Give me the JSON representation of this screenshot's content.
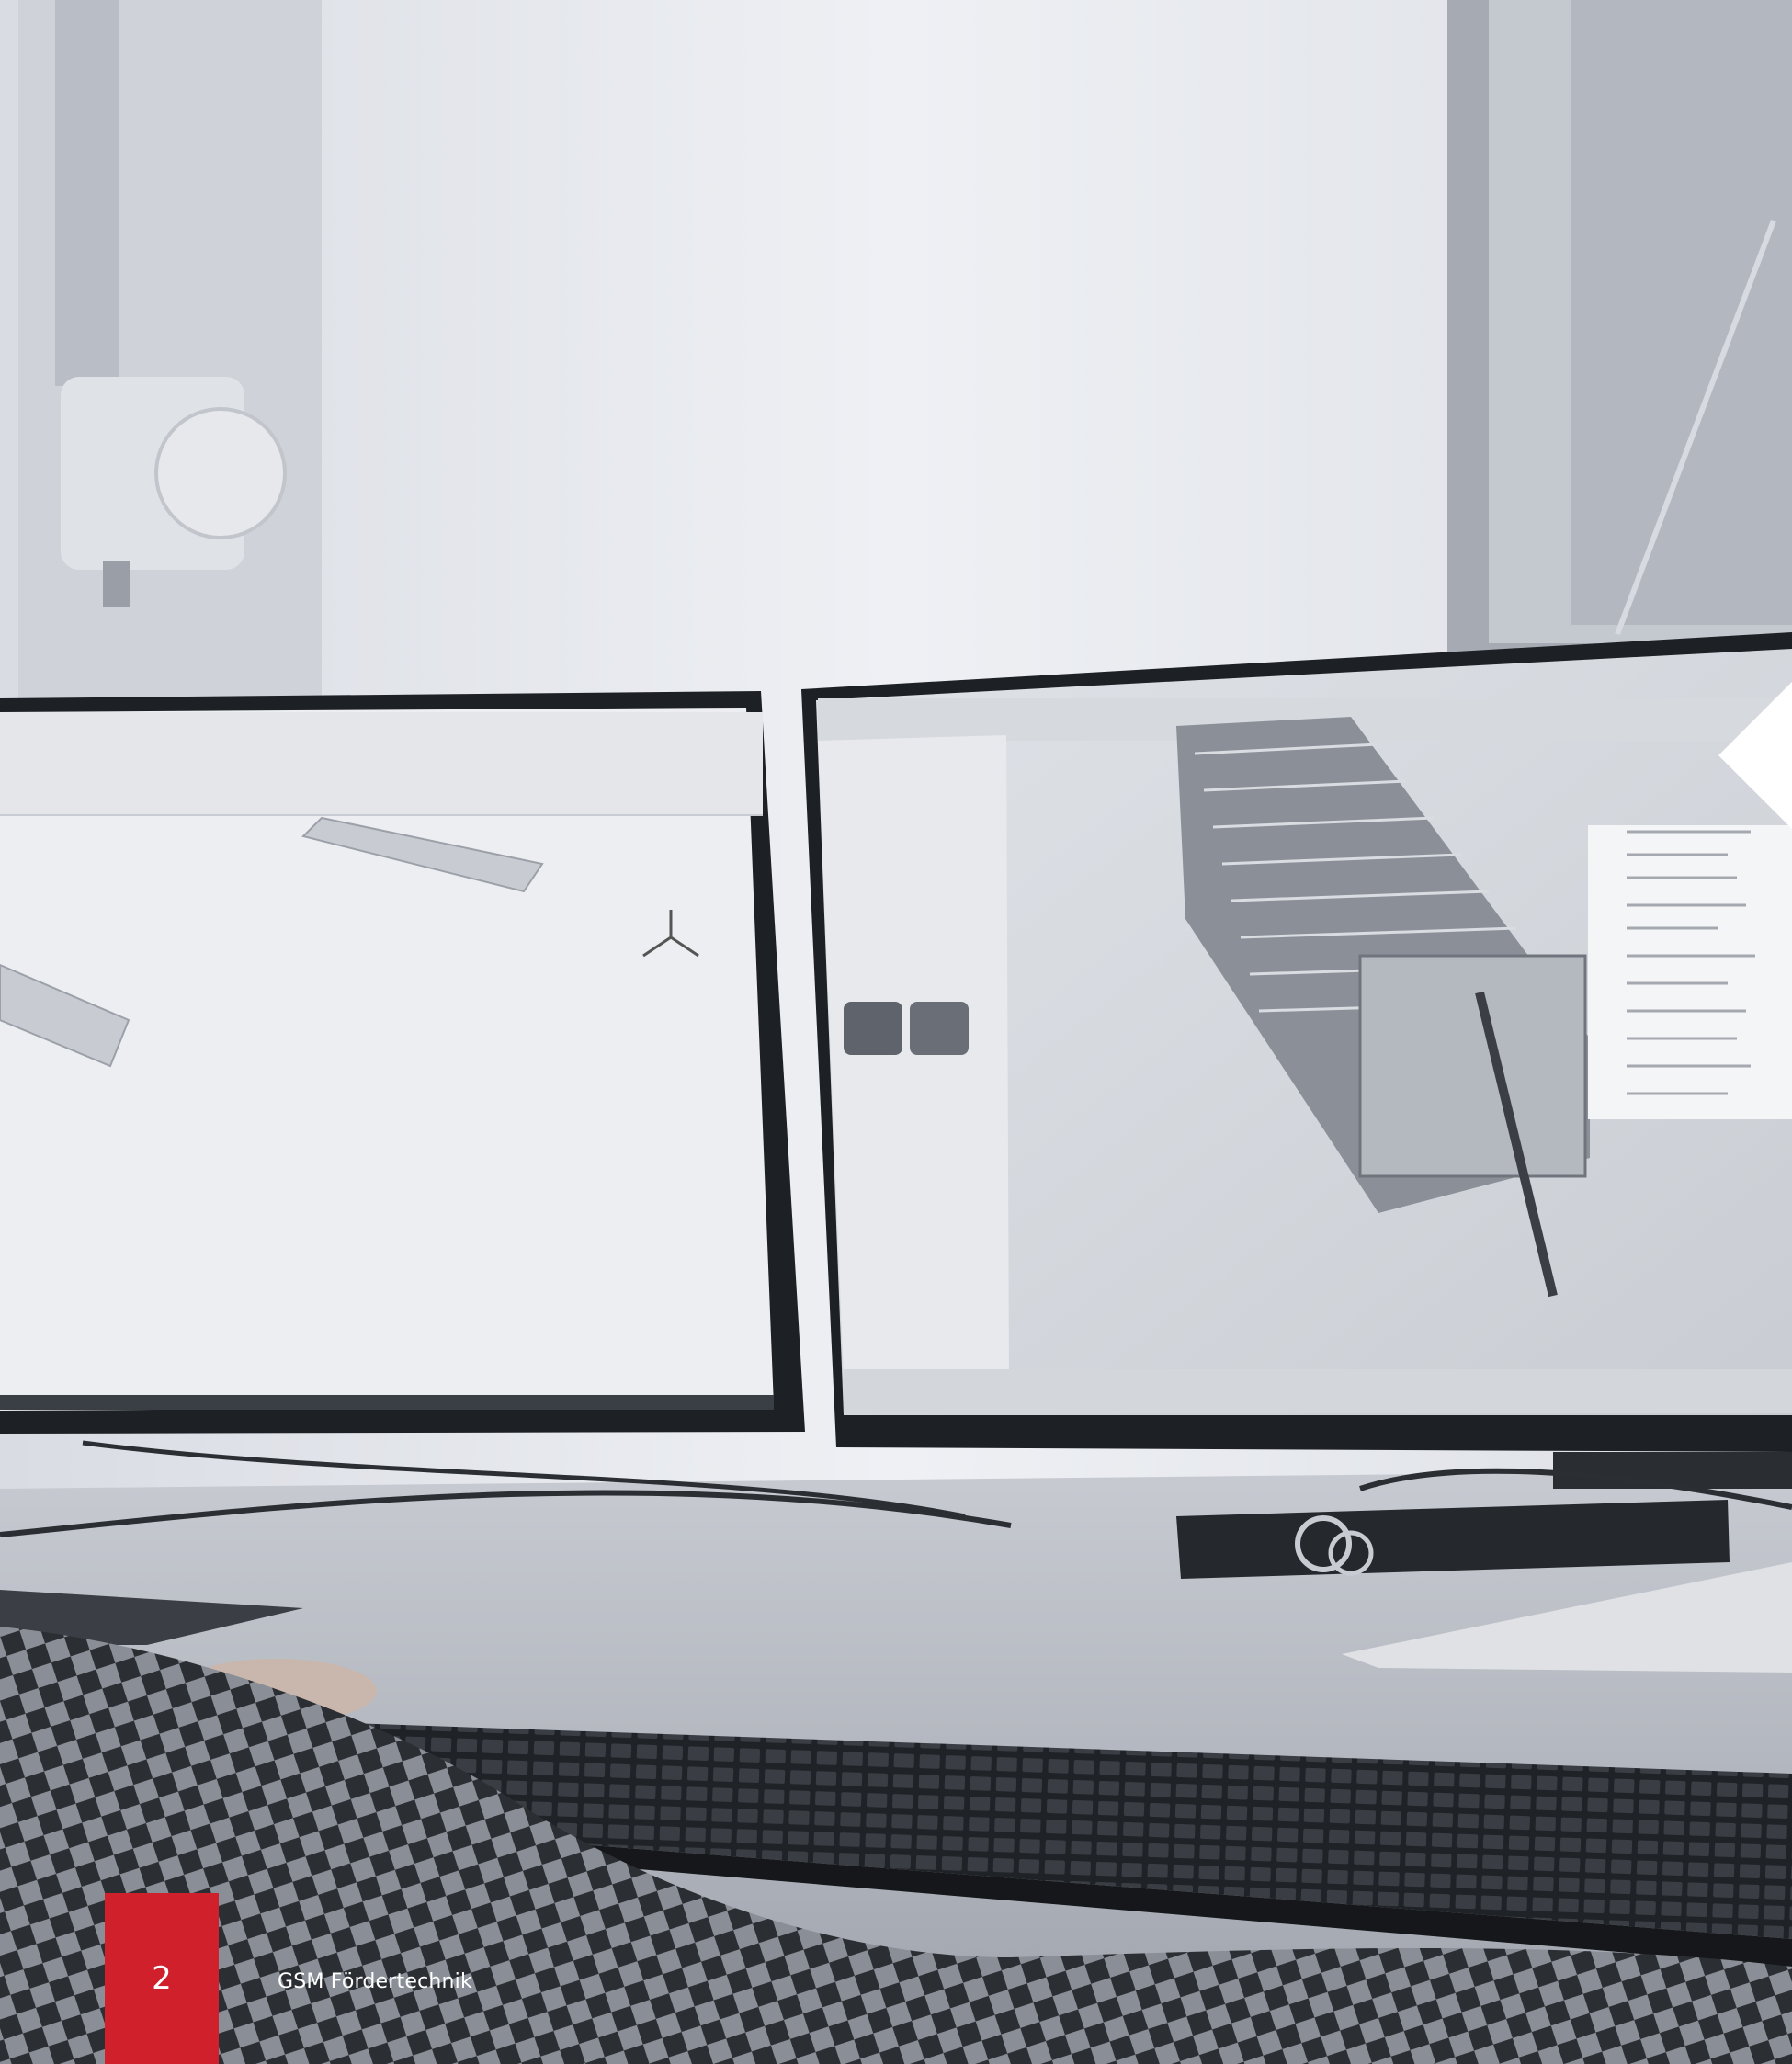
{
  "footer": {
    "page_number": "2",
    "company_name": "GSM Fördertechnik"
  },
  "colors": {
    "accent_red": "#d0202b",
    "wall": "#e9ebf0",
    "monitor_bezel": "#1d2024",
    "desk": "#b8bcc4",
    "keyboard": "#2a2d32"
  },
  "icons": {
    "chevron": "left-chevron-icon"
  }
}
